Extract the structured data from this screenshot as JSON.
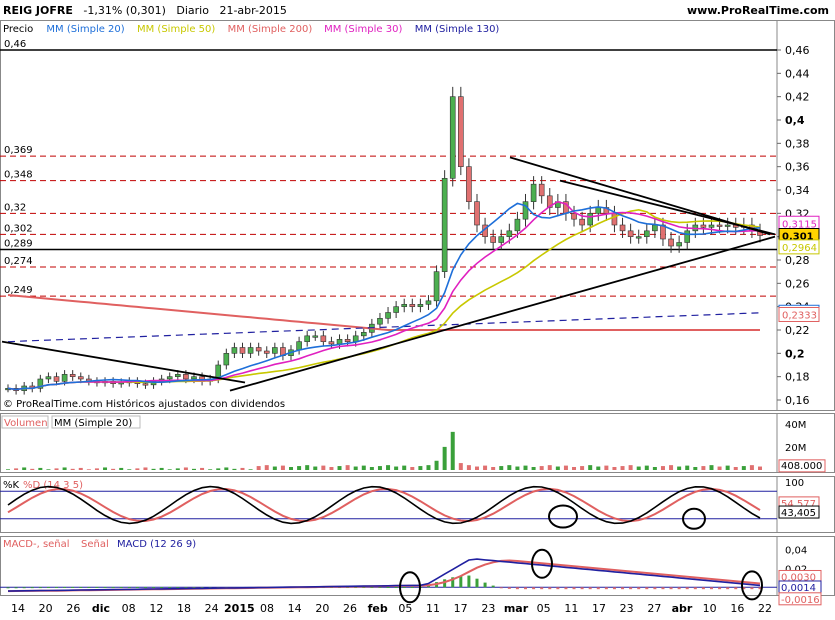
{
  "header": {
    "ticker": "REIG JOFRE",
    "change": "-1,31% (0,301)",
    "period": "Diario",
    "date": "21-abr-2015",
    "site": "www.ProRealTime.com"
  },
  "copyright": "© ProRealTime.com  Históricos ajustados con dividendos",
  "price_panel": {
    "legend": [
      {
        "label": "Precio",
        "color": "#000000"
      },
      {
        "label": "MM (Simple 20)",
        "color": "#1e6fd9"
      },
      {
        "label": "MM (Simple 50)",
        "color": "#c8c800"
      },
      {
        "label": "MM (Simple 200)",
        "color": "#e06060"
      },
      {
        "label": "MM (Simple 30)",
        "color": "#e020c0"
      },
      {
        "label": "MM (Simple 130)",
        "color": "#2020a0"
      }
    ],
    "y_ticks": [
      "0,46",
      "0,44",
      "0,42",
      "0,4",
      "0,38",
      "0,36",
      "0,34",
      "0,32",
      "0,3",
      "0,28",
      "0,26",
      "0,24",
      "0,22",
      "0,2",
      "0,18",
      "0,16"
    ],
    "levels_left": [
      "0,46",
      "0,369",
      "0,348",
      "0,32",
      "0,302",
      "0,289",
      "0,274",
      "0,249"
    ],
    "value_tags": [
      {
        "text": "0,3115",
        "color": "#e020c0"
      },
      {
        "text": "0,301",
        "color": "#000000"
      },
      {
        "text": "0,2964",
        "color": "#c8c800"
      },
      {
        "text": "0,2352",
        "color": "#1e6fd9"
      },
      {
        "text": "0,2333",
        "color": "#e06060"
      }
    ]
  },
  "volume_panel": {
    "legend": [
      {
        "label": "Volumen",
        "color": "#e06060"
      },
      {
        "label": "MM (Simple 20)",
        "color": "#000000"
      }
    ],
    "y_ticks": [
      "40M",
      "20M"
    ],
    "value_tag": "408.000"
  },
  "stoch_panel": {
    "legend": [
      {
        "label": "%K",
        "color": "#000000"
      },
      {
        "label": "%D (14 3 5)",
        "color": "#e06060"
      }
    ],
    "y_ticks": [
      "100",
      "50"
    ],
    "value_tags": [
      "54,577",
      "43,405"
    ]
  },
  "macd_panel": {
    "legend": [
      {
        "label": "MACD-, señal",
        "color": "#e06060"
      },
      {
        "label": "Señal",
        "color": "#e06060"
      },
      {
        "label": "MACD (12 26 9)",
        "color": "#2020a0"
      }
    ],
    "y_ticks": [
      "0,04",
      "0,02",
      "0"
    ],
    "value_tags": [
      "0,0030",
      "0,0014",
      "-0,0016"
    ]
  },
  "x_axis": [
    "14",
    "20",
    "26",
    "dic",
    "08",
    "12",
    "18",
    "24",
    "2015",
    "08",
    "14",
    "20",
    "26",
    "feb",
    "05",
    "11",
    "17",
    "23",
    "mar",
    "05",
    "11",
    "17",
    "23",
    "27",
    "abr",
    "10",
    "16",
    "22"
  ],
  "chart_data": {
    "type": "candlestick",
    "title": "REIG JOFRE",
    "ylim": [
      0.15,
      0.47
    ],
    "horizontal_levels": [
      0.46,
      0.369,
      0.348,
      0.32,
      0.302,
      0.289,
      0.274,
      0.249
    ],
    "last_close": 0.301,
    "close": [
      0.17,
      0.168,
      0.172,
      0.17,
      0.178,
      0.18,
      0.176,
      0.182,
      0.18,
      0.178,
      0.176,
      0.175,
      0.176,
      0.174,
      0.175,
      0.176,
      0.174,
      0.173,
      0.176,
      0.178,
      0.18,
      0.182,
      0.178,
      0.18,
      0.176,
      0.178,
      0.19,
      0.2,
      0.205,
      0.2,
      0.205,
      0.202,
      0.2,
      0.205,
      0.198,
      0.203,
      0.21,
      0.215,
      0.215,
      0.21,
      0.208,
      0.212,
      0.21,
      0.215,
      0.218,
      0.225,
      0.23,
      0.235,
      0.24,
      0.242,
      0.24,
      0.242,
      0.245,
      0.27,
      0.35,
      0.42,
      0.36,
      0.33,
      0.31,
      0.3,
      0.295,
      0.3,
      0.305,
      0.315,
      0.33,
      0.345,
      0.335,
      0.325,
      0.33,
      0.32,
      0.315,
      0.31,
      0.32,
      0.325,
      0.32,
      0.31,
      0.305,
      0.3,
      0.3,
      0.305,
      0.31,
      0.298,
      0.292,
      0.295,
      0.305,
      0.31,
      0.308,
      0.31,
      0.309,
      0.31,
      0.308,
      0.31,
      0.305,
      0.301
    ],
    "ma_close": [
      {
        "name": "MM (Simple 20)",
        "values_start": 0.19,
        "values_end": 0.31
      },
      {
        "name": "MM (Simple 50)",
        "values_start": 0.23,
        "values_end": 0.2964
      },
      {
        "name": "MM (Simple 200)",
        "values_start": 0.25,
        "values_end": 0.2333
      }
    ]
  }
}
